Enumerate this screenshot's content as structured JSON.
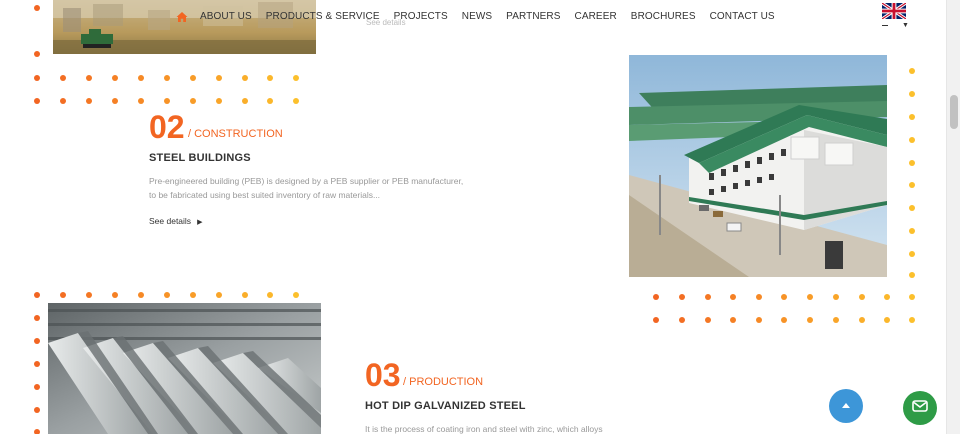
{
  "nav": {
    "items": [
      "ABOUT US",
      "PRODUCTS & SERVICE",
      "PROJECTS",
      "NEWS",
      "PARTNERS",
      "CAREER",
      "BROCHURES",
      "CONTACT US"
    ],
    "home_icon": "home-icon",
    "language_flag": "uk-flag-icon"
  },
  "ghost_link": "See details",
  "sections": [
    {
      "number": "02",
      "category": "/ CONSTRUCTION",
      "title": "STEEL BUILDINGS",
      "description_line1": "Pre-engineered building (PEB) is designed by a PEB supplier or PEB manufacturer,",
      "description_line2": "to be fabricated using best suited inventory of raw materials...",
      "link": "See details"
    },
    {
      "number": "03",
      "category": "/ PRODUCTION",
      "title": "HOT DIP GALVANIZED STEEL",
      "description_line1": "It is the process of coating iron and steel with zinc, which alloys"
    }
  ],
  "colors": {
    "accent": "#f26522",
    "dot_gradient_start": "#f26522",
    "dot_gradient_end": "#fcc02c",
    "scroll_top_button": "#3d96d8",
    "mail_button": "#2e9b46"
  },
  "icons": {
    "scroll_top": "chevron-up-icon",
    "mail": "mail-icon"
  }
}
